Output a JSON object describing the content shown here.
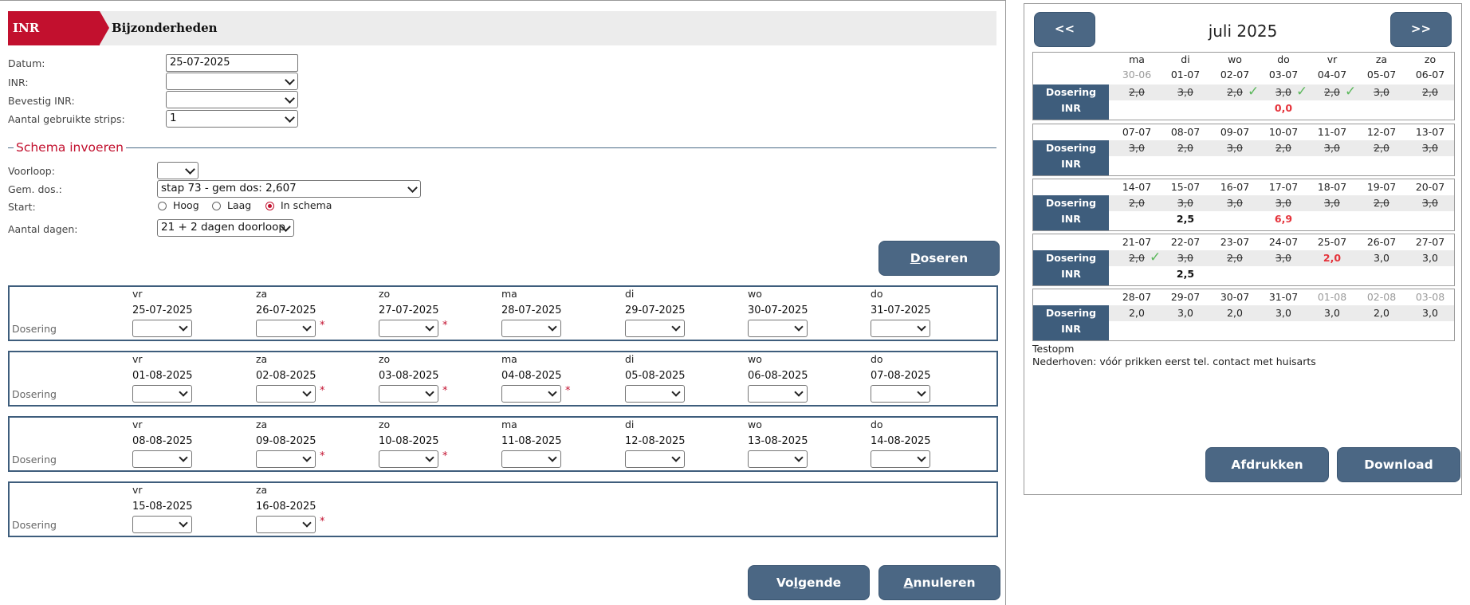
{
  "tabs": {
    "active": "INR invoeren",
    "second": "Bijzonderheden"
  },
  "form": {
    "datum_label": "Datum:",
    "datum_value": "25-07-2025",
    "inr_label": "INR:",
    "inr_value": "",
    "bevestig_label": "Bevestig INR:",
    "bevestig_value": "",
    "strips_label": "Aantal gebruikte strips:",
    "strips_value": "1"
  },
  "schema": {
    "legend": "Schema invoeren",
    "voorloop_label": "Voorloop:",
    "voorloop_value": "",
    "gemdos_label": "Gem. dos.:",
    "gemdos_value": "stap 73 - gem dos: 2,607",
    "start_label": "Start:",
    "start_options": [
      "Hoog",
      "Laag",
      "In schema"
    ],
    "start_selected": "In schema",
    "dagen_label": "Aantal dagen:",
    "dagen_value": "21 + 2 dagen doorloop"
  },
  "buttons": {
    "doseren": "oseren",
    "doseren_u": "D",
    "volgende_pre": "Vo",
    "volgende_u": "l",
    "volgende_post": "gende",
    "annuleren_u": "A",
    "annuleren": "nnuleren",
    "afdrukken": "Afdrukken",
    "download": "Download",
    "prev": "<<",
    "next": ">>"
  },
  "schedule": {
    "row_label": "Dosering",
    "weeks": [
      {
        "days": [
          "vr",
          "za",
          "zo",
          "ma",
          "di",
          "wo",
          "do"
        ],
        "dates": [
          "25-07-2025",
          "26-07-2025",
          "27-07-2025",
          "28-07-2025",
          "29-07-2025",
          "30-07-2025",
          "31-07-2025"
        ],
        "stars": [
          "",
          "*",
          "*",
          "",
          "",
          "",
          ""
        ]
      },
      {
        "days": [
          "vr",
          "za",
          "zo",
          "ma",
          "di",
          "wo",
          "do"
        ],
        "dates": [
          "01-08-2025",
          "02-08-2025",
          "03-08-2025",
          "04-08-2025",
          "05-08-2025",
          "06-08-2025",
          "07-08-2025"
        ],
        "stars": [
          "",
          "*",
          "*",
          "*",
          "",
          "",
          ""
        ]
      },
      {
        "days": [
          "vr",
          "za",
          "zo",
          "ma",
          "di",
          "wo",
          "do"
        ],
        "dates": [
          "08-08-2025",
          "09-08-2025",
          "10-08-2025",
          "11-08-2025",
          "12-08-2025",
          "13-08-2025",
          "14-08-2025"
        ],
        "stars": [
          "",
          "*",
          "*",
          "",
          "",
          "",
          ""
        ]
      },
      {
        "days": [
          "vr",
          "za"
        ],
        "dates": [
          "15-08-2025",
          "16-08-2025"
        ],
        "stars": [
          "",
          "*"
        ]
      }
    ]
  },
  "calendar": {
    "month": "juli 2025",
    "dos_label": "Dosering",
    "inr_label": "INR",
    "weekdays": [
      "ma",
      "di",
      "wo",
      "do",
      "vr",
      "za",
      "zo"
    ],
    "weeks": [
      {
        "dates": [
          "30-06",
          "01-07",
          "02-07",
          "03-07",
          "04-07",
          "05-07",
          "06-07"
        ],
        "muted": [
          true,
          false,
          false,
          false,
          false,
          false,
          false
        ],
        "dos": [
          "2,0",
          "3,0",
          "2,0",
          "3,0",
          "2,0",
          "3,0",
          "2,0"
        ],
        "strike": [
          true,
          true,
          true,
          true,
          true,
          true,
          true
        ],
        "dosred": [
          false,
          false,
          false,
          false,
          false,
          false,
          false
        ],
        "checks": [
          false,
          false,
          true,
          true,
          true,
          false,
          false
        ],
        "inr": [
          "",
          "",
          "",
          "0,0",
          "",
          "",
          ""
        ],
        "inrred": [
          false,
          false,
          false,
          true,
          false,
          false,
          false
        ]
      },
      {
        "dates": [
          "07-07",
          "08-07",
          "09-07",
          "10-07",
          "11-07",
          "12-07",
          "13-07"
        ],
        "muted": [
          false,
          false,
          false,
          false,
          false,
          false,
          false
        ],
        "dos": [
          "3,0",
          "2,0",
          "3,0",
          "2,0",
          "3,0",
          "2,0",
          "3,0"
        ],
        "strike": [
          true,
          true,
          true,
          true,
          true,
          true,
          true
        ],
        "dosred": [
          false,
          false,
          false,
          false,
          false,
          false,
          false
        ],
        "checks": [
          false,
          false,
          false,
          false,
          false,
          false,
          false
        ],
        "inr": [
          "",
          "",
          "",
          "",
          "",
          "",
          ""
        ],
        "inrred": [
          false,
          false,
          false,
          false,
          false,
          false,
          false
        ]
      },
      {
        "dates": [
          "14-07",
          "15-07",
          "16-07",
          "17-07",
          "18-07",
          "19-07",
          "20-07"
        ],
        "muted": [
          false,
          false,
          false,
          false,
          false,
          false,
          false
        ],
        "dos": [
          "2,0",
          "3,0",
          "3,0",
          "3,0",
          "3,0",
          "2,0",
          "3,0"
        ],
        "strike": [
          true,
          true,
          true,
          true,
          true,
          true,
          true
        ],
        "dosred": [
          false,
          false,
          false,
          false,
          false,
          false,
          false
        ],
        "checks": [
          false,
          false,
          false,
          false,
          false,
          false,
          false
        ],
        "inr": [
          "",
          "2,5",
          "",
          "6,9",
          "",
          "",
          ""
        ],
        "inrred": [
          false,
          false,
          false,
          true,
          false,
          false,
          false
        ]
      },
      {
        "dates": [
          "21-07",
          "22-07",
          "23-07",
          "24-07",
          "25-07",
          "26-07",
          "27-07"
        ],
        "muted": [
          false,
          false,
          false,
          false,
          false,
          false,
          false
        ],
        "dos": [
          "2,0",
          "3,0",
          "2,0",
          "3,0",
          "2,0",
          "3,0",
          "3,0"
        ],
        "strike": [
          true,
          true,
          true,
          true,
          false,
          false,
          false
        ],
        "dosred": [
          false,
          false,
          false,
          false,
          true,
          false,
          false
        ],
        "checks": [
          true,
          false,
          false,
          false,
          false,
          false,
          false
        ],
        "inr": [
          "",
          "2,5",
          "",
          "",
          "",
          "",
          ""
        ],
        "inrred": [
          false,
          false,
          false,
          false,
          false,
          false,
          false
        ]
      },
      {
        "dates": [
          "28-07",
          "29-07",
          "30-07",
          "31-07",
          "01-08",
          "02-08",
          "03-08"
        ],
        "muted": [
          false,
          false,
          false,
          false,
          true,
          true,
          true
        ],
        "dos": [
          "2,0",
          "3,0",
          "2,0",
          "3,0",
          "3,0",
          "2,0",
          "3,0"
        ],
        "strike": [
          false,
          false,
          false,
          false,
          false,
          false,
          false
        ],
        "dosred": [
          false,
          false,
          false,
          false,
          false,
          false,
          false
        ],
        "checks": [
          false,
          false,
          false,
          false,
          false,
          false,
          false
        ],
        "inr": [
          "",
          "",
          "",
          "",
          "",
          "",
          ""
        ],
        "inrred": [
          false,
          false,
          false,
          false,
          false,
          false,
          false
        ]
      }
    ],
    "notes": [
      "Testopm",
      "Nederhoven: vóór prikken eerst tel. contact met huisarts"
    ]
  }
}
